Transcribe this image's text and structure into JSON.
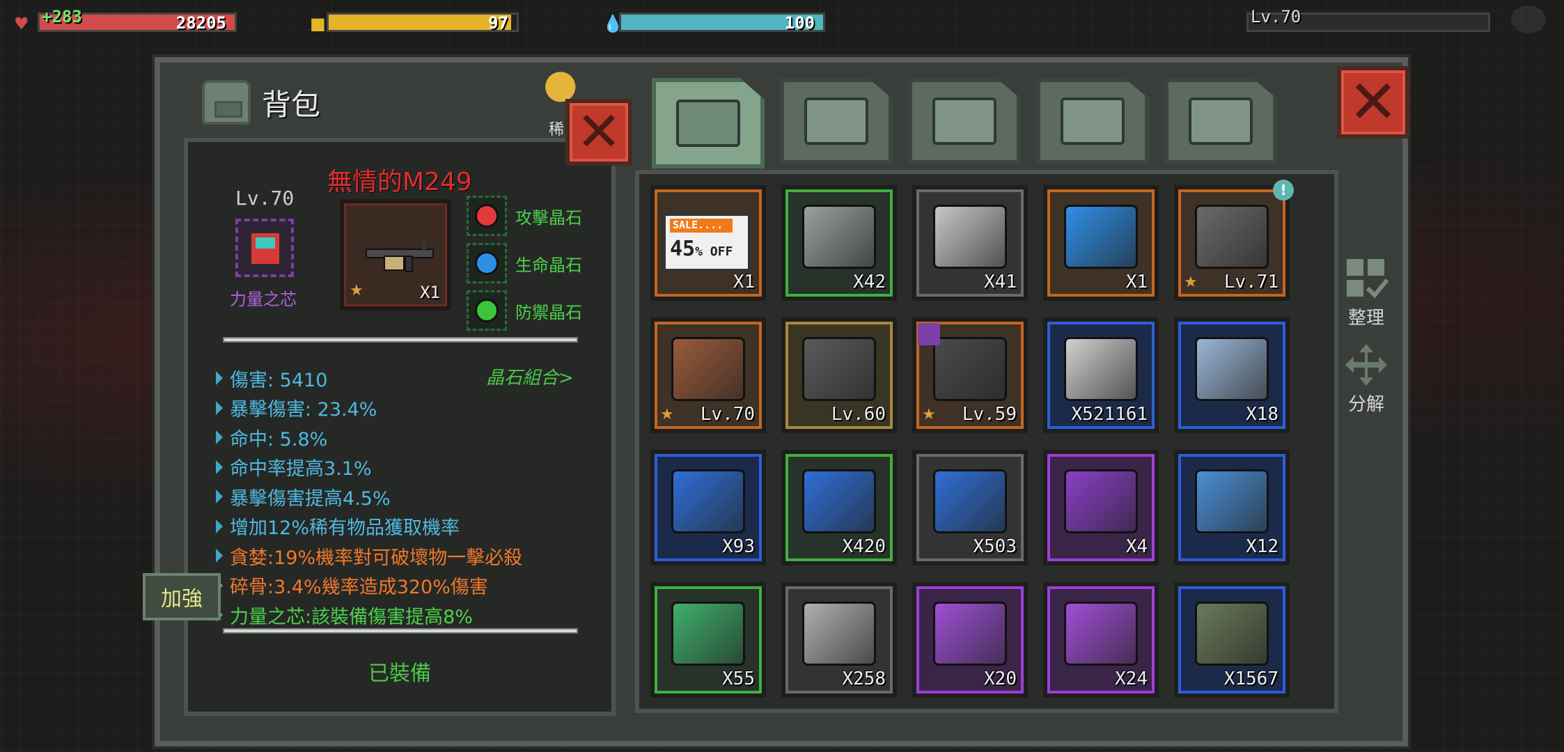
{
  "hud": {
    "hp_gain": "+283",
    "hp_value": "28205",
    "hp_fill": 1.0,
    "food_value": "97",
    "food_fill": 0.97,
    "water_value": "100",
    "water_fill": 1.0,
    "level": "Lv.70",
    "xp_fill": 0.0
  },
  "panel": {
    "title": "背包",
    "cut_label": "稀"
  },
  "detail": {
    "weapon_name": "無情的M249",
    "core_level": "Lv.70",
    "core_name": "力量之芯",
    "weapon_qty": "X1",
    "gems": [
      {
        "label": "攻擊晶石",
        "color": "#e23a3a"
      },
      {
        "label": "生命晶石",
        "color": "#2f8fe6"
      },
      {
        "label": "防禦晶石",
        "color": "#3cc43c"
      }
    ],
    "combo_link": "晶石組合>",
    "stats": [
      {
        "text": "傷害: 5410",
        "color": "#4fb9e0"
      },
      {
        "text": "暴擊傷害: 23.4%",
        "color": "#4fb9e0"
      },
      {
        "text": "命中: 5.8%",
        "color": "#4fb9e0"
      },
      {
        "text": "命中率提高3.1%",
        "color": "#4fb9e0"
      },
      {
        "text": "暴擊傷害提高4.5%",
        "color": "#4fb9e0"
      },
      {
        "text": "增加12%稀有物品獲取機率",
        "color": "#4fb9e0"
      },
      {
        "text": "貪婪:19%機率對可破壞物一擊必殺",
        "color": "#f0782a"
      },
      {
        "text": "碎骨:3.4%幾率造成320%傷害",
        "color": "#f0782a"
      },
      {
        "text": "力量之芯:該裝備傷害提高8%",
        "color": "#4ad24a"
      }
    ],
    "equipped_label": "已裝備",
    "enhance_label": "加強"
  },
  "tabs": [
    {
      "name": "backpack",
      "icon": "backpack-icon",
      "active": true
    },
    {
      "name": "medical",
      "icon": "medkit-icon",
      "active": false
    },
    {
      "name": "armor",
      "icon": "armor-icon",
      "active": false
    },
    {
      "name": "weapons",
      "icon": "pistol-icon",
      "active": false
    },
    {
      "name": "tools",
      "icon": "wrench-icon",
      "active": false
    }
  ],
  "items": [
    {
      "icon": "sale-coupon-icon",
      "qty": "X1",
      "rarity": "orange",
      "art": "#f07a1a",
      "sale_text": "SALE....",
      "discount": "45",
      "off": "% OFF"
    },
    {
      "icon": "green-crate-icon",
      "qty": "X42",
      "rarity": "green",
      "art": "#9aa0a0"
    },
    {
      "icon": "white-crate-icon",
      "qty": "X41",
      "rarity": "gray",
      "art": "#c8c8c8"
    },
    {
      "icon": "blueprint-tablet-icon",
      "qty": "X1",
      "rarity": "orange",
      "art": "#2f8fe6"
    },
    {
      "icon": "pistol-icon",
      "qty": "Lv.71",
      "rarity": "orange",
      "art": "#6a6a6a",
      "star": true,
      "badge": "!"
    },
    {
      "icon": "shotgun-icon",
      "qty": "Lv.70",
      "rarity": "orange",
      "art": "#9c5a3a",
      "star": true
    },
    {
      "icon": "assault-rifle-icon",
      "qty": "Lv.60",
      "rarity": "gold",
      "art": "#5a5a5a"
    },
    {
      "icon": "crossbow-icon",
      "qty": "Lv.59",
      "rarity": "orange",
      "art": "#4a4a4a",
      "star": true,
      "purple_badge": true
    },
    {
      "icon": "silver-coin-icon",
      "qty": "X521161",
      "rarity": "blue",
      "art": "#d0d0d0"
    },
    {
      "icon": "map-fragment-icon",
      "qty": "X18",
      "rarity": "blue",
      "art": "#9ab6d6"
    },
    {
      "icon": "blue-core-module-icon",
      "qty": "X93",
      "rarity": "blue",
      "art": "#2f6fd6"
    },
    {
      "icon": "green-core-module-icon",
      "qty": "X420",
      "rarity": "green",
      "art": "#2f6fd6"
    },
    {
      "icon": "gray-core-module-icon",
      "qty": "X503",
      "rarity": "gray",
      "art": "#2f6fd6"
    },
    {
      "icon": "purple-wrench-kit-icon",
      "qty": "X4",
      "rarity": "purple",
      "art": "#8a3fc6"
    },
    {
      "icon": "blue-wrench-kit-icon",
      "qty": "X12",
      "rarity": "blue",
      "art": "#4a8fd6"
    },
    {
      "icon": "green-wrench-kit-icon",
      "qty": "X55",
      "rarity": "green",
      "art": "#3fb06a"
    },
    {
      "icon": "gray-wrench-kit-icon",
      "qty": "X258",
      "rarity": "gray",
      "art": "#b0b0b0"
    },
    {
      "icon": "purple-armor-case-icon",
      "qty": "X20",
      "rarity": "purple",
      "art": "#a04fd6"
    },
    {
      "icon": "purple-gun-case-icon",
      "qty": "X24",
      "rarity": "purple",
      "art": "#a04fd6"
    },
    {
      "icon": "ammo-clip-icon",
      "qty": "X1567",
      "rarity": "blue",
      "art": "#6a7a5a"
    }
  ],
  "side": {
    "sort_label": "整理",
    "decompose_label": "分解"
  }
}
